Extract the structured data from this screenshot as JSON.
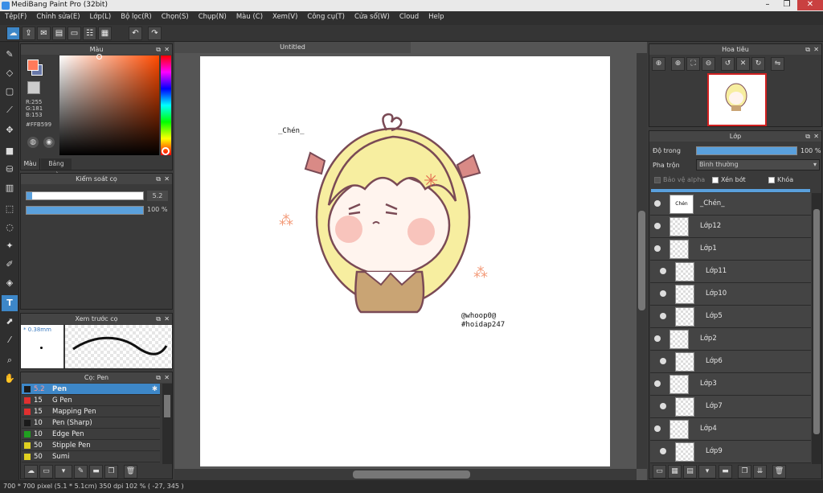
{
  "window": {
    "title": "MediBang Paint Pro (32bit)"
  },
  "menu": [
    "Tệp(F)",
    "Chỉnh sửa(E)",
    "Lớp(L)",
    "Bộ lọc(R)",
    "Chọn(S)",
    "Chụp(N)",
    "Màu (C)",
    "Xem(V)",
    "Công cụ(T)",
    "Cửa sổ(W)",
    "Cloud",
    "Help"
  ],
  "color_panel": {
    "title": "Màu",
    "r": "R:255",
    "g": "G:181",
    "b": "B:153",
    "hex": "#FFB599",
    "tab_color": "Màu",
    "tab_palette": "Bảng màu",
    "fg_color": "#ffb599"
  },
  "brush_control": {
    "title": "Kiểm soát cọ",
    "size": "5.2",
    "opacity": "100 %",
    "size_frac": 0.05,
    "opacity_frac": 1.0
  },
  "brush_preview": {
    "title": "Xem trước cọ",
    "size_label": "* 0.38mm"
  },
  "brush_list": {
    "title": "Cọ: Pen",
    "items": [
      {
        "size": "5.2",
        "name": "Pen",
        "color": "#1a1a1a"
      },
      {
        "size": "15",
        "name": "G Pen",
        "color": "#e03030"
      },
      {
        "size": "15",
        "name": "Mapping Pen",
        "color": "#e03030"
      },
      {
        "size": "10",
        "name": "Pen (Sharp)",
        "color": "#1a1a1a"
      },
      {
        "size": "10",
        "name": "Edge Pen",
        "color": "#20a020"
      },
      {
        "size": "50",
        "name": "Stipple Pen",
        "color": "#e0d020"
      },
      {
        "size": "50",
        "name": "Sumi",
        "color": "#e0d020"
      }
    ]
  },
  "canvas": {
    "tab": "Untitled",
    "text_name": "_Chén_",
    "text_sig1": "@whoop0@",
    "text_sig2": "#hoidap247"
  },
  "navigator": {
    "title": "Hoa tiêu"
  },
  "layer_panel": {
    "title": "Lớp",
    "opacity_label": "Độ trong",
    "opacity_value": "100 %",
    "blend_label": "Pha trộn",
    "blend_value": "Bình thường",
    "protect_alpha": "Bảo vệ alpha",
    "clipping": "Xén bớt",
    "lock": "Khóa",
    "layers": [
      {
        "name": "_Chén_",
        "thumb": "Chén"
      },
      {
        "name": "Lớp12"
      },
      {
        "name": "Lớp1"
      },
      {
        "name": "Lớp11"
      },
      {
        "name": "Lớp10"
      },
      {
        "name": "Lớp5"
      },
      {
        "name": "Lớp2"
      },
      {
        "name": "Lớp6"
      },
      {
        "name": "Lớp3"
      },
      {
        "name": "Lớp7"
      },
      {
        "name": "Lớp4"
      },
      {
        "name": "Lớp9"
      }
    ]
  },
  "status": {
    "text": "700 * 700 pixel   (5.1 * 5.1cm)   350 dpi   102 %   ( -27, 345 )"
  }
}
